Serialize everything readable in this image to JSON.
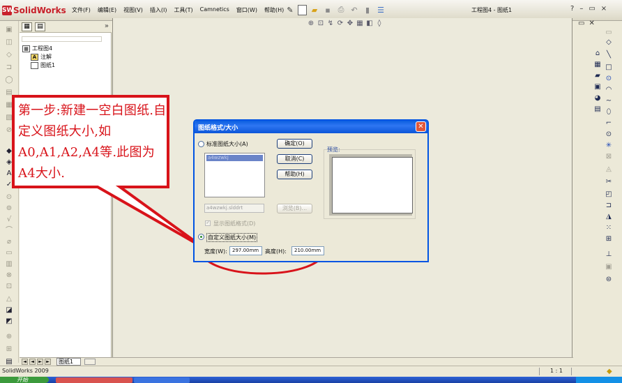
{
  "app": {
    "name": "SolidWorks",
    "logo_letters": "SW"
  },
  "menu": [
    "文件(F)",
    "编辑(E)",
    "视图(V)",
    "插入(I)",
    "工具(T)",
    "Camnetics",
    "窗口(W)",
    "帮助(H)"
  ],
  "window": {
    "doc_title": "工程图4 - 图纸1",
    "help": "?",
    "minimize": "–",
    "restore": "▭",
    "close": "×"
  },
  "tree": {
    "root": "工程图4",
    "items": [
      {
        "label": "注解",
        "icon": "annotation-icon"
      },
      {
        "label": "图纸1",
        "icon": "sheet-icon"
      }
    ],
    "expand_glyph": "»"
  },
  "dialog": {
    "title": "图纸格式/大小",
    "standard_label": "标准图纸大小(A)",
    "std_list_selected": "a4wzwkj",
    "file_field": "a4wzwkj.slddrt",
    "ok": "确定(O)",
    "cancel": "取消(C)",
    "help": "帮助(H)",
    "browse": "浏览(B)...",
    "show_format": "显示图纸格式(D)",
    "preview_label": "预览:",
    "custom_label": "自定义图纸大小(M)",
    "width_label": "宽度(W):",
    "width_value": "297.00mm",
    "height_label": "高度(H):",
    "height_value": "210.00mm",
    "standard_selected": false,
    "custom_selected": true,
    "show_format_checked": true
  },
  "callout": {
    "text": "第一步:新建一空白图纸.自定义图纸大小,如A0,A1,A2,A4等.此图为A4大小."
  },
  "sheet_tab": "图纸1",
  "status": {
    "text": "SolidWorks 2009",
    "scale": "1 : 1"
  },
  "taskbar": {
    "start": "开始"
  },
  "colors": {
    "annotation_red": "#D8131A",
    "dialog_title": "#0A5FE0",
    "brand_red": "#C8202A"
  }
}
